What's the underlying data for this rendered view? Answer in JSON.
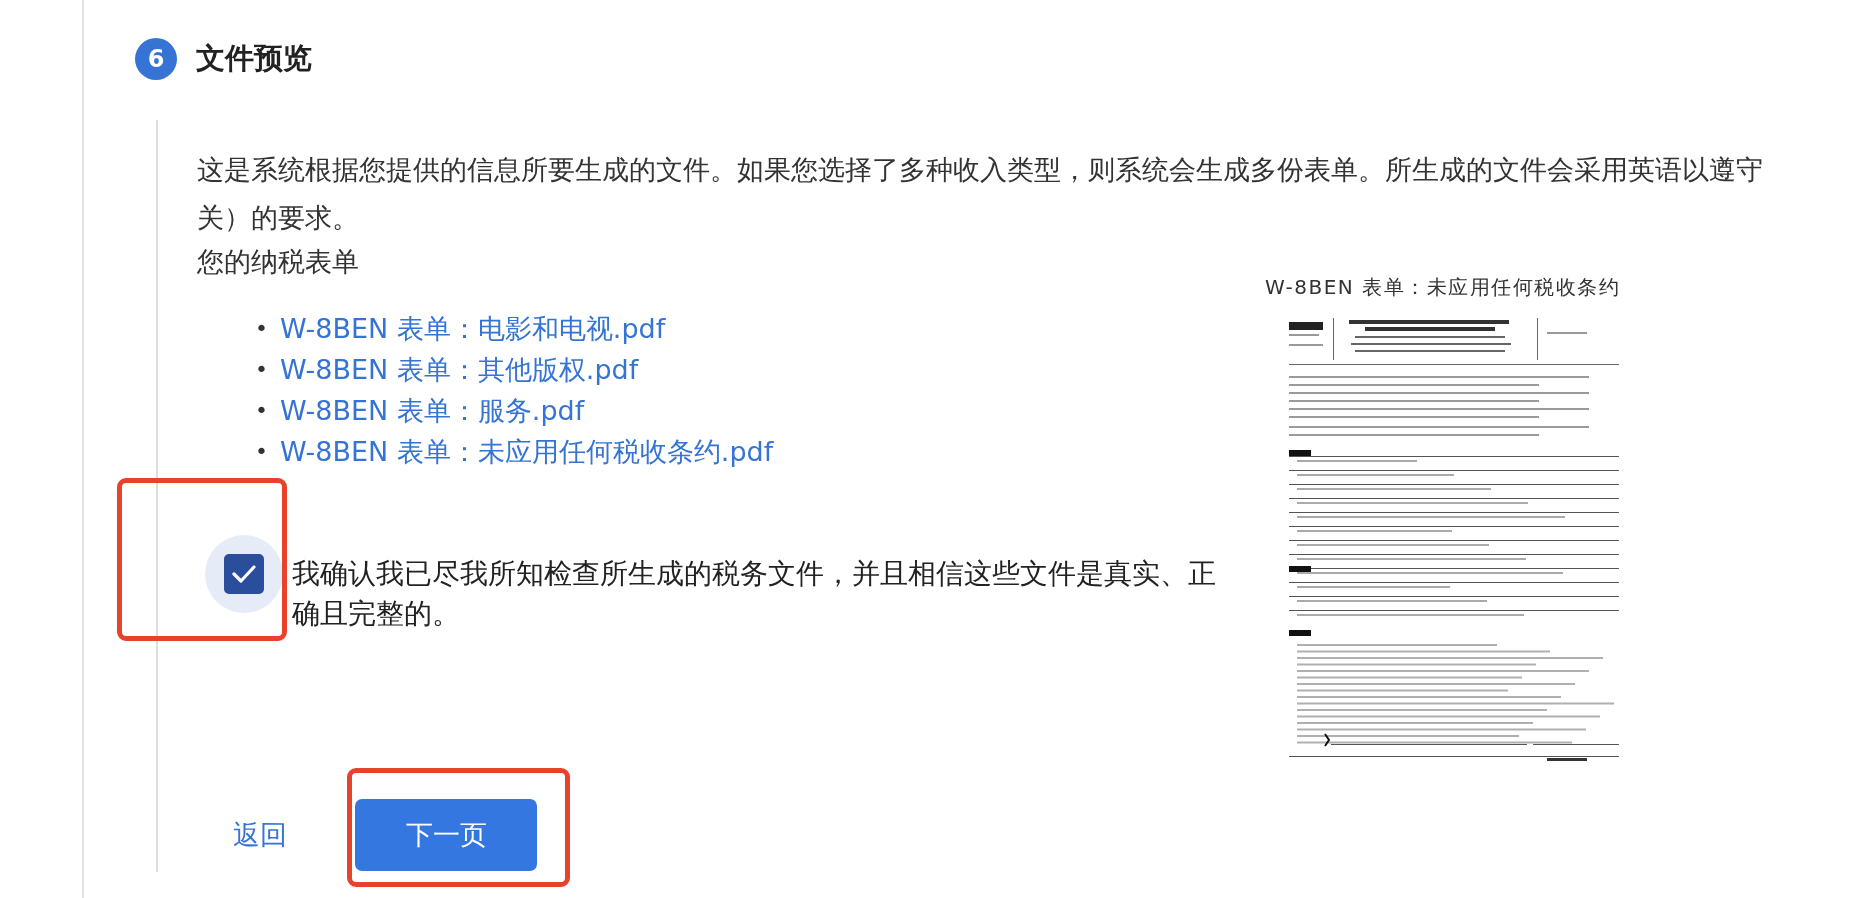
{
  "step": {
    "number": "6",
    "title": "文件预览"
  },
  "description": {
    "lines": [
      "这是系统根据您提供的信息所要生成的文件。如果您选择了多种收入类型，则系统会生成多份表单。所生成的文件会采用英语以遵守",
      "关）的要求。"
    ]
  },
  "forms_heading": "您的纳税表单",
  "forms": [
    {
      "bullet": "•",
      "label": "W-8BEN 表单：电影和电视.pdf"
    },
    {
      "bullet": "•",
      "label": "W-8BEN 表单：其他版权.pdf"
    },
    {
      "bullet": "•",
      "label": "W-8BEN 表单：服务.pdf"
    },
    {
      "bullet": "•",
      "label": "W-8BEN 表单：未应用任何税收条约.pdf"
    }
  ],
  "confirmation": {
    "checked": true,
    "highlighted": true,
    "label": "我确认我已尽我所知检查所生成的税务文件，并且相信这些文件是真实、正确且完整的。"
  },
  "buttons": [
    {
      "kind": "link",
      "label": "返回"
    },
    {
      "kind": "primary",
      "label": "下一页",
      "highlighted": true
    }
  ],
  "preview": {
    "title": "W-8BEN 表单：未应用任何税收条约"
  }
}
